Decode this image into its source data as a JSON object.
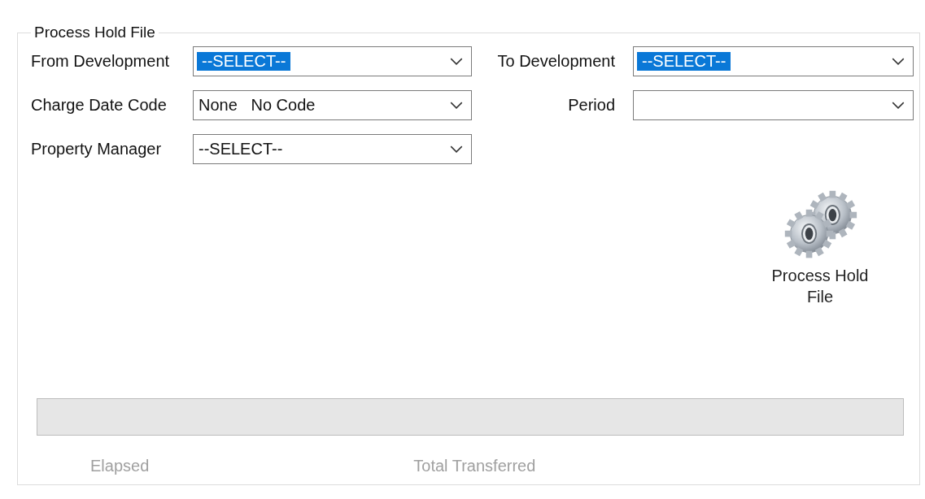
{
  "group": {
    "title": "Process Hold File"
  },
  "left_fields": [
    {
      "label": "From Development",
      "value": "--SELECT--",
      "highlighted": true
    },
    {
      "label": "Charge Date Code",
      "value": "None   No Code",
      "highlighted": false
    },
    {
      "label": "Property Manager",
      "value": "--SELECT--",
      "highlighted": false
    }
  ],
  "right_fields": [
    {
      "label": "To Development",
      "value": "--SELECT--",
      "highlighted": true
    },
    {
      "label": "Period"
    }
  ],
  "action_button": {
    "label": "Process Hold File"
  },
  "status_labels": [
    {
      "text": "Elapsed",
      "disabled": true
    },
    {
      "text": "Total Transferred",
      "disabled": true
    }
  ]
}
